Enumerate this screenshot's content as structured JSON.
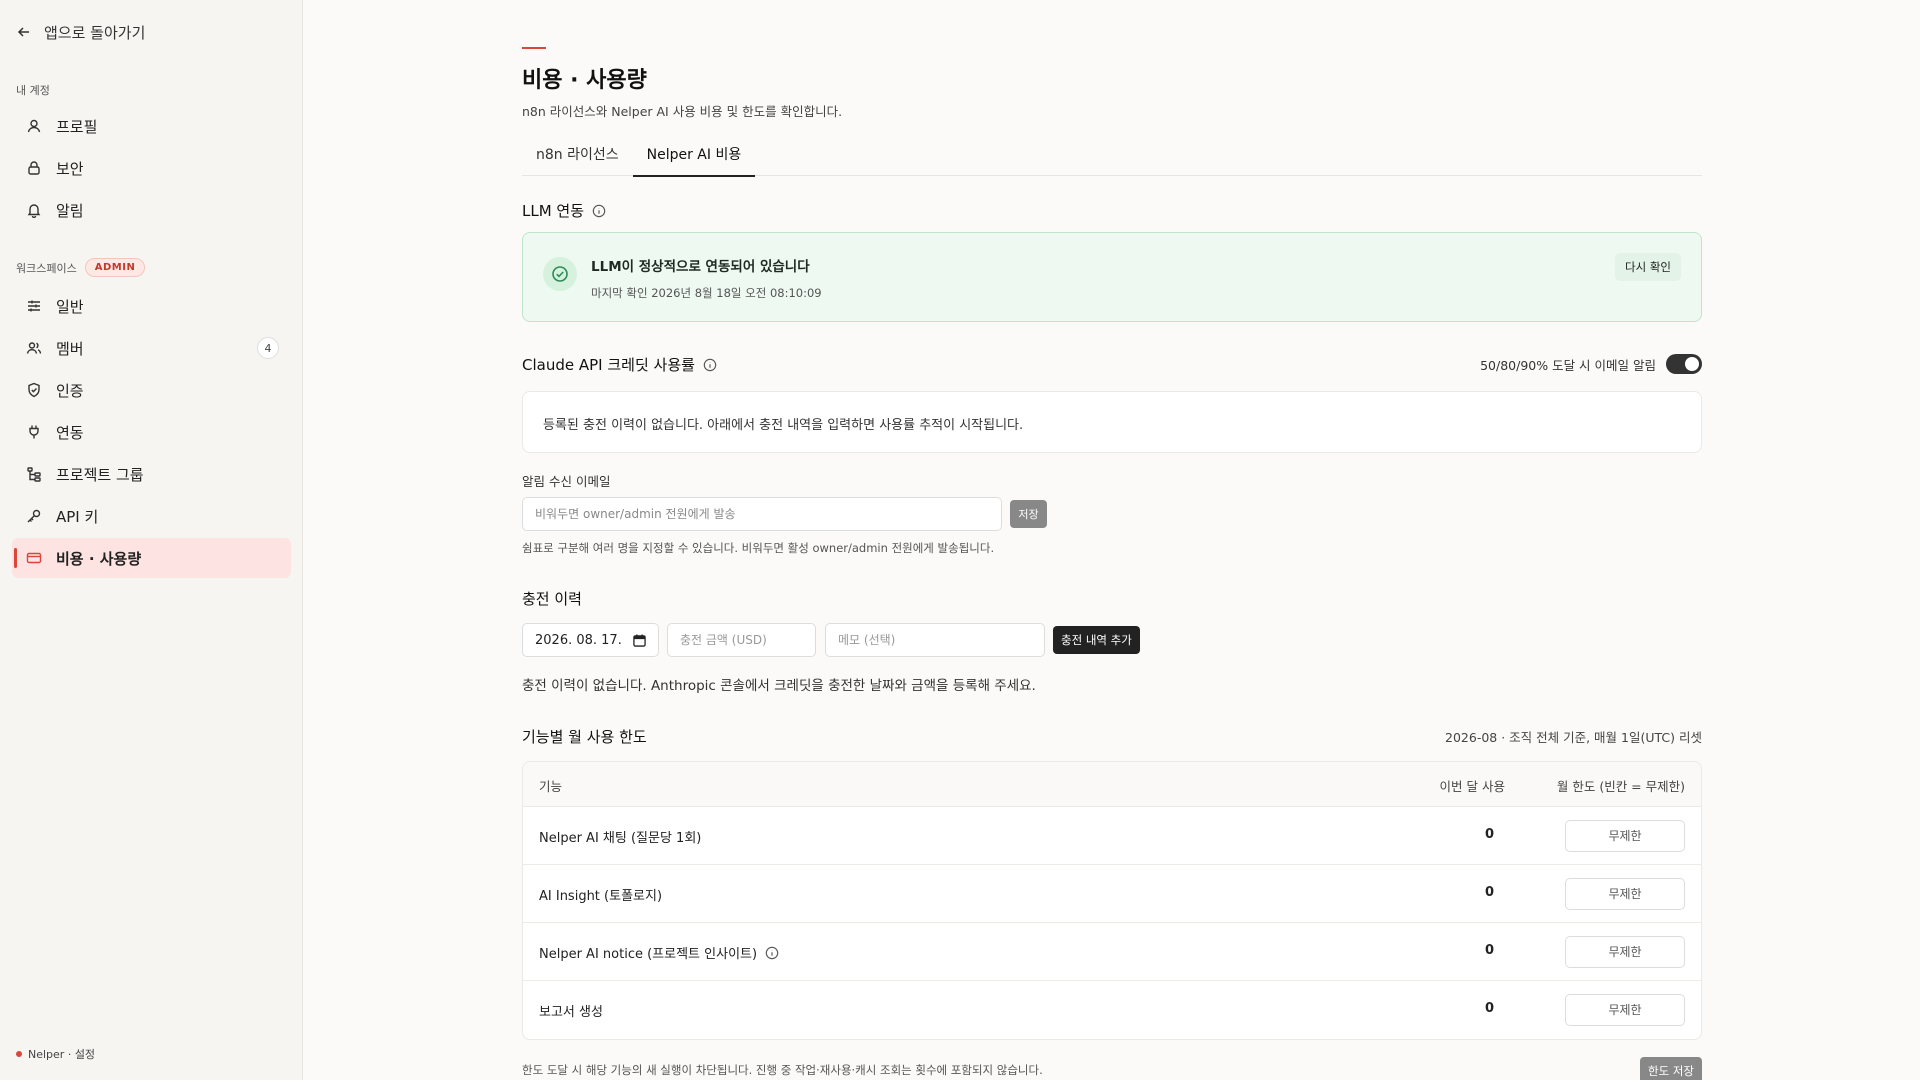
{
  "sidebar": {
    "back_label": "앱으로 돌아가기",
    "account_label": "내 계정",
    "workspace_label": "워크스페이스",
    "admin_badge": "ADMIN",
    "account_items": [
      {
        "label": "프로필",
        "icon": "user-icon"
      },
      {
        "label": "보안",
        "icon": "lock-icon"
      },
      {
        "label": "알림",
        "icon": "bell-icon"
      }
    ],
    "workspace_items": [
      {
        "label": "일반",
        "icon": "sliders-icon"
      },
      {
        "label": "멤버",
        "icon": "users-icon",
        "count": "4"
      },
      {
        "label": "인증",
        "icon": "shield-icon"
      },
      {
        "label": "연동",
        "icon": "plug-icon"
      },
      {
        "label": "프로젝트 그룹",
        "icon": "tree-icon"
      },
      {
        "label": "API 키",
        "icon": "key-icon"
      },
      {
        "label": "비용 · 사용량",
        "icon": "card-icon",
        "active": true
      }
    ],
    "footer": "Nelper · 설정"
  },
  "page": {
    "title": "비용 · 사용량",
    "subtitle": "n8n 라이선스와 Nelper AI 사용 비용 및 한도를 확인합니다.",
    "tabs": [
      {
        "label": "n8n 라이선스",
        "active": false
      },
      {
        "label": "Nelper AI 비용",
        "active": true
      }
    ]
  },
  "llm": {
    "title": "LLM 연동",
    "status": "LLM이 정상적으로 연동되어 있습니다",
    "last_checked": "마지막 확인 2026년 8월 18일 오전 08:10:09",
    "recheck_label": "다시 확인"
  },
  "credit": {
    "title": "Claude API 크레딧 사용률",
    "alert_label": "50/80/90% 도달 시 이메일 알림",
    "alert_enabled": true,
    "empty_text": "등록된 충전 이력이 없습니다. 아래에서 충전 내역을 입력하면 사용률 추적이 시작됩니다.",
    "email_label": "알림 수신 이메일",
    "email_placeholder": "비워두면 owner/admin 전원에게 발송",
    "email_value": "",
    "save_label": "저장",
    "email_help": "쉼표로 구분해 여러 명을 지정할 수 있습니다. 비워두면 활성 owner/admin 전원에게 발송됩니다."
  },
  "charge": {
    "title": "충전 이력",
    "date_value": "2026. 08. 17.",
    "amount_placeholder": "충전 금액 (USD)",
    "memo_placeholder": "메모 (선택)",
    "add_label": "충전 내역 추가",
    "empty_text": "충전 이력이 없습니다. Anthropic 콘솔에서 크레딧을 충전한 날짜와 금액을 등록해 주세요."
  },
  "limits": {
    "title": "기능별 월 사용 한도",
    "meta": "2026-08 · 조직 전체 기준, 매월 1일(UTC) 리셋",
    "columns": [
      "기능",
      "이번 달 사용",
      "월 한도 (빈칸 = 무제한)"
    ],
    "rows": [
      {
        "name": "Nelper AI 채팅 (질문당 1회)",
        "usage": "0",
        "placeholder": "무제한",
        "info": false
      },
      {
        "name": "AI Insight (토폴로지)",
        "usage": "0",
        "placeholder": "무제한",
        "info": false
      },
      {
        "name": "Nelper AI notice (프로젝트 인사이트)",
        "usage": "0",
        "placeholder": "무제한",
        "info": true
      },
      {
        "name": "보고서 생성",
        "usage": "0",
        "placeholder": "무제한",
        "info": false
      }
    ],
    "footer_note": "한도 도달 시 해당 기능의 새 실행이 차단됩니다. 진행 중 작업·재사용·캐시 조회는 횟수에 포함되지 않습니다.",
    "save_label": "한도 저장"
  },
  "colors": {
    "accent": "#d9463a",
    "success_bg": "#eef9f1",
    "success_border": "#bfe6cb"
  }
}
